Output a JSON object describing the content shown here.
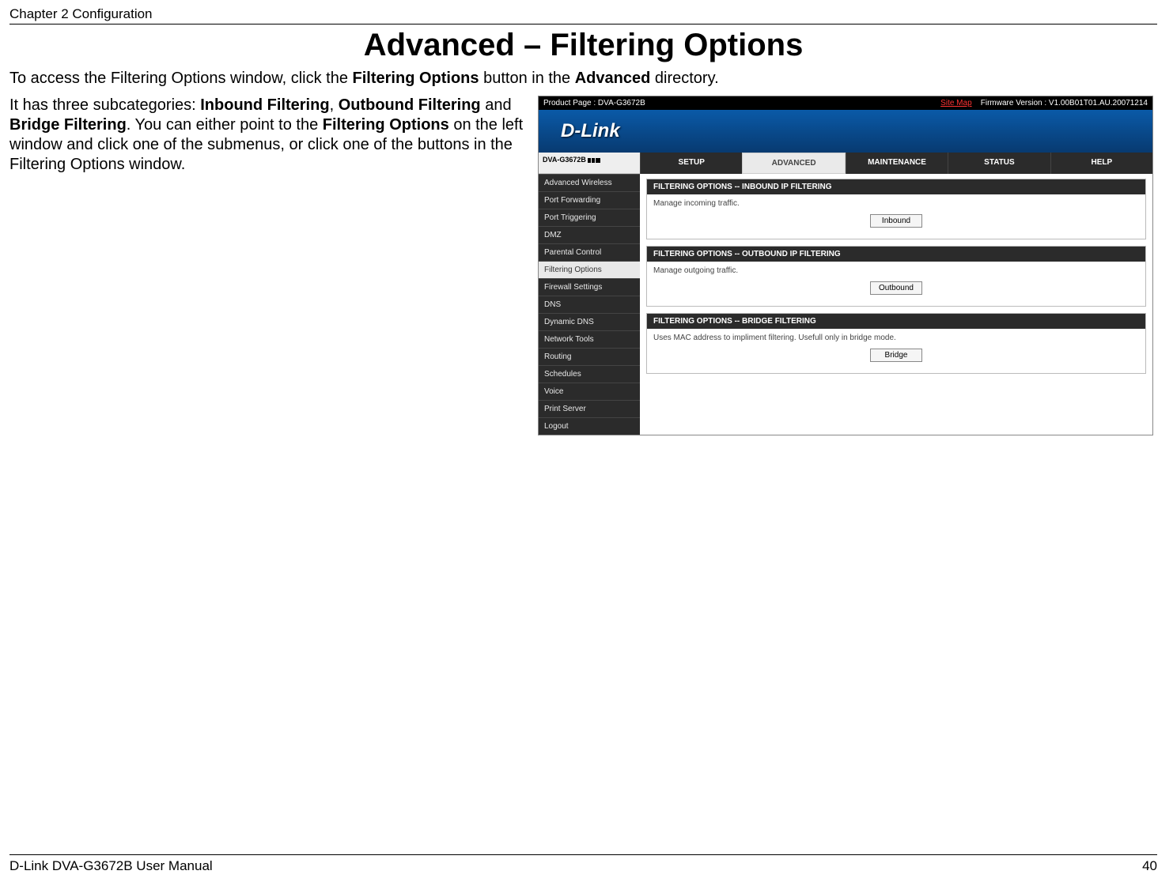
{
  "header": "Chapter 2 Configuration",
  "title": "Advanced – Filtering Options",
  "intro": {
    "pre": "To access the Filtering Options window, click the ",
    "b1": "Filtering Options",
    "mid": " button in the ",
    "b2": "Advanced",
    "post": " directory."
  },
  "left": {
    "p1a": "It has three subcategories: ",
    "p1b": "Inbound Filtering",
    "p1c": ", ",
    "p1d": "Outbound Filtering",
    "p1e": " and ",
    "p1f": "Bridge Filtering",
    "p1g": ". You can either point to the ",
    "p1h": "Filtering Options",
    "p1i": " on the left window and click one of the submenus, or click one of the buttons in the Filtering Options window."
  },
  "shot": {
    "product": "Product Page : DVA-G3672B",
    "sitemap": "Site Map",
    "firmware": "Firmware Version :   V1.00B01T01.AU.20071214",
    "brand": "D-Link",
    "model": "DVA-G3672B",
    "tabs": [
      "SETUP",
      "ADVANCED",
      "MAINTENANCE",
      "STATUS",
      "HELP"
    ],
    "side": [
      "Advanced Wireless",
      "Port Forwarding",
      "Port Triggering",
      "DMZ",
      "Parental Control",
      "Filtering Options",
      "Firewall Settings",
      "DNS",
      "Dynamic DNS",
      "Network Tools",
      "Routing",
      "Schedules",
      "Voice",
      "Print Server",
      "Logout"
    ],
    "panels": [
      {
        "head": "FILTERING OPTIONS -- INBOUND IP FILTERING",
        "desc": "Manage incoming traffic.",
        "btn": "Inbound"
      },
      {
        "head": "FILTERING OPTIONS -- OUTBOUND IP FILTERING",
        "desc": "Manage outgoing traffic.",
        "btn": "Outbound"
      },
      {
        "head": "FILTERING OPTIONS -- BRIDGE FILTERING",
        "desc": "Uses MAC address to impliment filtering. Usefull only in bridge mode.",
        "btn": "Bridge"
      }
    ]
  },
  "footer": {
    "left": "D-Link DVA-G3672B User Manual",
    "right": "40"
  }
}
